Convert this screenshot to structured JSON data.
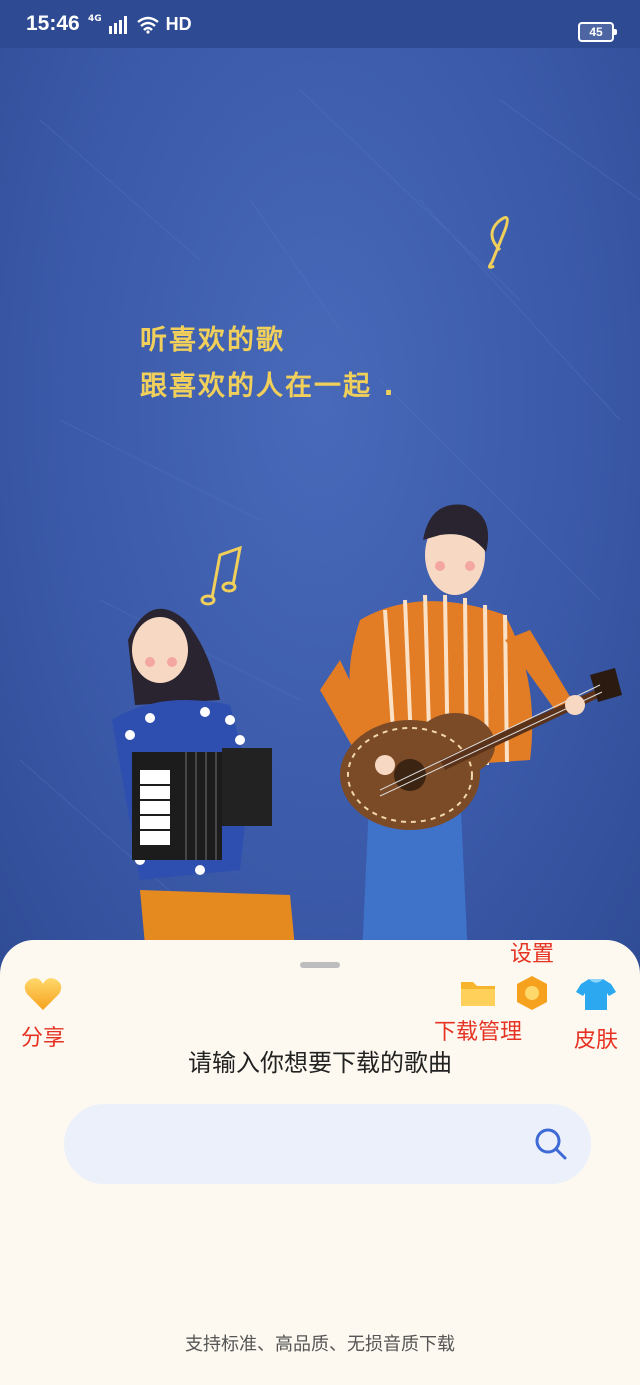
{
  "status_bar": {
    "time": "15:46",
    "network": "4G",
    "hd": "HD",
    "battery": "45"
  },
  "poster": {
    "line1": "听喜欢的歌",
    "line2": "跟喜欢的人在一起 ."
  },
  "toolbar": {
    "share": "分享",
    "downloads": "下载管理",
    "settings": "设置",
    "skin": "皮肤"
  },
  "search": {
    "title": "请输入你想要下载的歌曲",
    "placeholder": ""
  },
  "footer": "支持标准、高品质、无损音质下载",
  "colors": {
    "accent_label": "#e53222",
    "background_blue": "#3b5aa9",
    "sheet": "#fdf9f0",
    "search_bg": "#ebf0fb",
    "icon_blue": "#3e6ad6"
  }
}
